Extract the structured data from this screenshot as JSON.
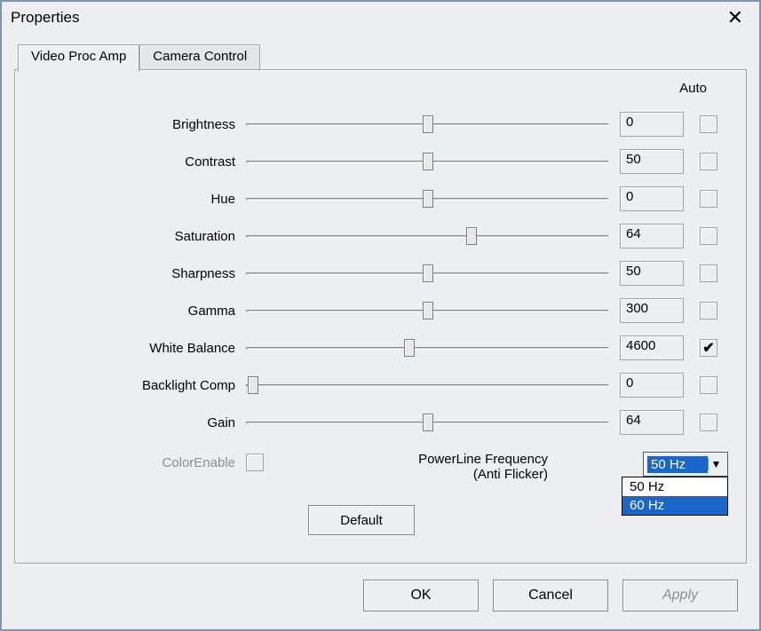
{
  "window": {
    "title": "Properties"
  },
  "tabs": {
    "video_proc_amp": "Video Proc Amp",
    "camera_control": "Camera Control"
  },
  "headers": {
    "auto": "Auto"
  },
  "rows": [
    {
      "label": "Brightness",
      "value": "0",
      "auto": false,
      "pos": 50
    },
    {
      "label": "Contrast",
      "value": "50",
      "auto": false,
      "pos": 50
    },
    {
      "label": "Hue",
      "value": "0",
      "auto": false,
      "pos": 50
    },
    {
      "label": "Saturation",
      "value": "64",
      "auto": false,
      "pos": 62
    },
    {
      "label": "Sharpness",
      "value": "50",
      "auto": false,
      "pos": 50
    },
    {
      "label": "Gamma",
      "value": "300",
      "auto": false,
      "pos": 50
    },
    {
      "label": "White Balance",
      "value": "4600",
      "auto": true,
      "pos": 45
    },
    {
      "label": "Backlight Comp",
      "value": "0",
      "auto": false,
      "pos": 2
    },
    {
      "label": "Gain",
      "value": "64",
      "auto": false,
      "pos": 50
    }
  ],
  "colorenable": {
    "label": "ColorEnable"
  },
  "powerline": {
    "label": "PowerLine Frequency",
    "sub": "(Anti Flicker)",
    "selected": "50 Hz",
    "options": [
      "50 Hz",
      "60 Hz"
    ],
    "hover_index": 1
  },
  "buttons": {
    "default": "Default",
    "ok": "OK",
    "cancel": "Cancel",
    "apply": "Apply"
  }
}
